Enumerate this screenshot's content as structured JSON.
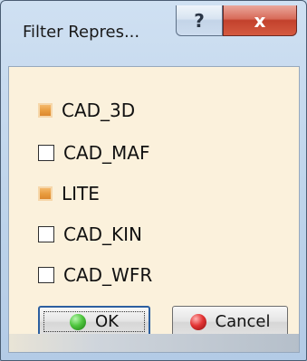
{
  "window": {
    "title": "Filter Repres...",
    "help_label": "?",
    "close_label": "x"
  },
  "filters": [
    {
      "label": "CAD_3D",
      "checked": true
    },
    {
      "label": "CAD_MAF",
      "checked": false
    },
    {
      "label": "LITE",
      "checked": true
    },
    {
      "label": "CAD_KIN",
      "checked": false
    },
    {
      "label": "CAD_WFR",
      "checked": false
    }
  ],
  "buttons": {
    "ok_label": "OK",
    "cancel_label": "Cancel",
    "ok_icon": "green-gem-icon",
    "cancel_icon": "red-gem-icon"
  },
  "colors": {
    "checked_fill": "#e89a3c",
    "panel_background": "#fbf1dc",
    "close_button": "#c2412c"
  }
}
